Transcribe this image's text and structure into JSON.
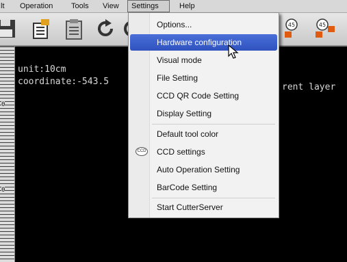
{
  "menubar": {
    "items": [
      "lt",
      "Operation",
      "Tools",
      "View",
      "Settings",
      "Help"
    ]
  },
  "toolbar": {
    "icons": [
      "save-icon",
      "open-file-icon",
      "clipboard-icon",
      "undo-icon",
      "rotate-45-icon",
      "rotate-45-alt-icon"
    ],
    "rotate_label_1": "45",
    "rotate_label_2": "45"
  },
  "ruler": {
    "labels": [
      "0",
      "0"
    ]
  },
  "console": {
    "line1": "unit:10cm",
    "line2": "coordinate:-543.5",
    "line3_tail": "rent layer"
  },
  "settings_menu": {
    "items": [
      {
        "label": "Options..."
      },
      {
        "label": "Hardware configuration"
      },
      {
        "label": "Visual mode"
      },
      {
        "label": "File Setting"
      },
      {
        "label": "CCD QR Code Setting"
      },
      {
        "label": "Display Setting"
      },
      {
        "label": "Default tool color"
      },
      {
        "label": "CCD settings",
        "icon_label": "CCD"
      },
      {
        "label": "Auto Operation Setting"
      },
      {
        "label": "BarCode Setting"
      },
      {
        "label": "Start CutterServer"
      }
    ]
  },
  "colors": {
    "highlight": "#3458c8",
    "background": "#000000",
    "menu_background": "#f2f2f2"
  }
}
